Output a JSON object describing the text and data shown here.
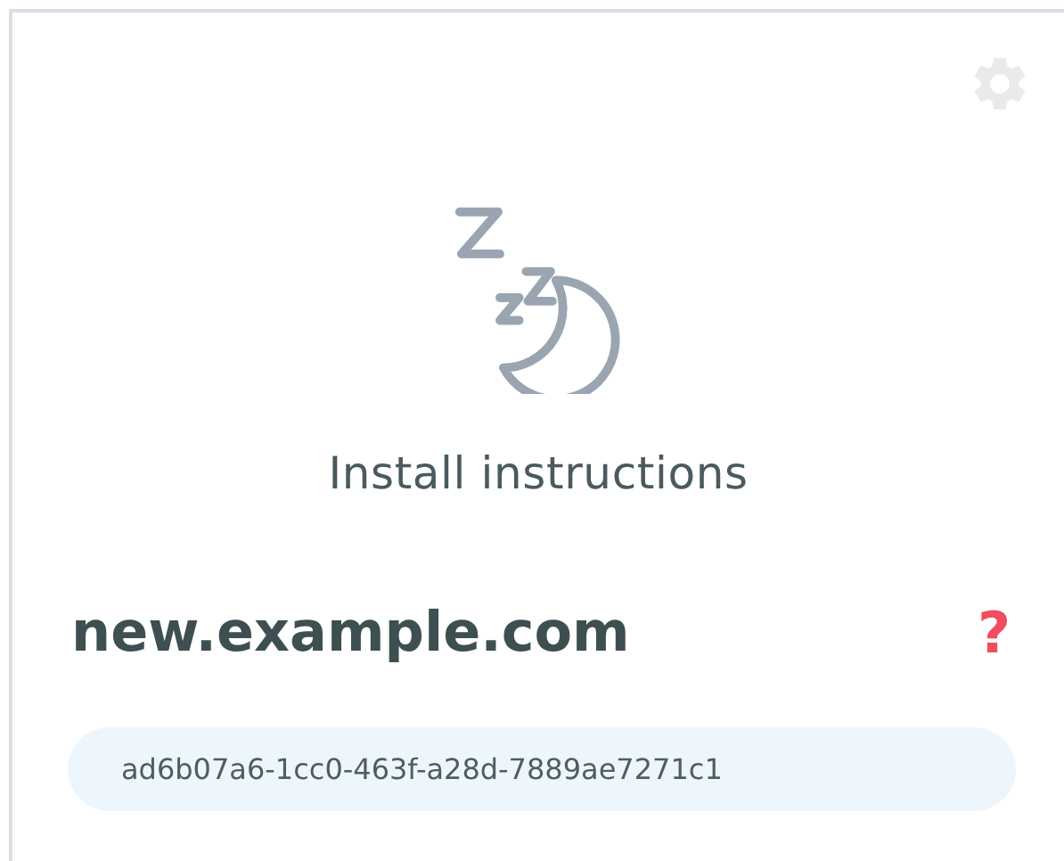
{
  "title": "Install instructions",
  "domain": {
    "name": "new.example.com",
    "help": "?"
  },
  "token": "ad6b07a6-1cc0-463f-a28d-7889ae7271c1"
}
